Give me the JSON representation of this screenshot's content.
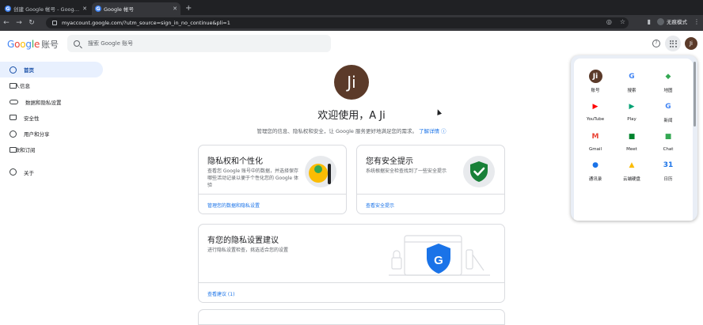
{
  "browser": {
    "tabs": [
      {
        "title": "创建 Google 帐号 - Google 帐号",
        "active": false
      },
      {
        "title": "Google 帐号",
        "active": true
      }
    ],
    "new_tab": "+",
    "url": "myaccount.google.com/?utm_source=sign_in_no_continue&pli=1",
    "mode_label": "无痕模式"
  },
  "header": {
    "logo": "Google",
    "logo_suffix": "账号",
    "search_placeholder": "搜索 Google 账号",
    "avatar_initials": "Ji"
  },
  "sidebar": {
    "items": [
      {
        "label": "首页",
        "icon": "home-icon",
        "active": true
      },
      {
        "label": "个人信息",
        "icon": "person-card-icon",
        "active": false
      },
      {
        "label": "数据和隐私设置",
        "icon": "toggle-icon",
        "active": false
      },
      {
        "label": "安全性",
        "icon": "lock-icon",
        "active": false
      },
      {
        "label": "用户和分享",
        "icon": "people-icon",
        "active": false
      },
      {
        "label": "付款和订阅",
        "icon": "credit-card-icon",
        "active": false
      }
    ],
    "about": {
      "label": "关于",
      "icon": "info-icon"
    }
  },
  "main": {
    "avatar_initials": "Ji",
    "welcome": "欢迎使用，A Ji",
    "subtitle": "管理您的信息、隐私权和安全，让 Google 服务更好地满足您的需求。",
    "subtitle_link": "了解详情",
    "cards": {
      "privacy": {
        "title": "隐私权和个性化",
        "desc": "查看您 Google 账号中的数据，并选择保存哪些活动记录以便于个性化您的 Google 体验",
        "link": "管理您的数据和隐私设置"
      },
      "security": {
        "title": "您有安全提示",
        "desc": "系统根据安全检查找到了一些安全提示",
        "link": "查看安全提示"
      },
      "recommendations": {
        "title": "有您的隐私设置建议",
        "desc": "进行隐私设置检查，挑选适合您的设置",
        "link": "查看建议 (1)"
      }
    }
  },
  "apps_panel": {
    "apps": [
      {
        "label": "账号",
        "glyph": "Ji",
        "color": "#5b3a29",
        "fg": "#ffffff",
        "icon": "account-avatar-icon"
      },
      {
        "label": "搜索",
        "glyph": "G",
        "color": "#ffffff",
        "fg": "#4285f4",
        "icon": "google-search-icon"
      },
      {
        "label": "地图",
        "glyph": "◆",
        "color": "#ffffff",
        "fg": "#34a853",
        "icon": "maps-icon"
      },
      {
        "label": "YouTube",
        "glyph": "▶",
        "color": "#ffffff",
        "fg": "#ff0000",
        "icon": "youtube-icon"
      },
      {
        "label": "Play",
        "glyph": "▶",
        "color": "#ffffff",
        "fg": "#00a173",
        "icon": "play-icon"
      },
      {
        "label": "新闻",
        "glyph": "G",
        "color": "#ffffff",
        "fg": "#4285f4",
        "icon": "news-icon"
      },
      {
        "label": "Gmail",
        "glyph": "M",
        "color": "#ffffff",
        "fg": "#ea4335",
        "icon": "gmail-icon"
      },
      {
        "label": "Meet",
        "glyph": "■",
        "color": "#ffffff",
        "fg": "#00832d",
        "icon": "meet-icon"
      },
      {
        "label": "Chat",
        "glyph": "■",
        "color": "#ffffff",
        "fg": "#34a853",
        "icon": "chat-icon"
      },
      {
        "label": "通讯录",
        "glyph": "●",
        "color": "#ffffff",
        "fg": "#1a73e8",
        "icon": "contacts-icon"
      },
      {
        "label": "云端硬盘",
        "glyph": "▲",
        "color": "#ffffff",
        "fg": "#fbbc04",
        "icon": "drive-icon"
      },
      {
        "label": "日历",
        "glyph": "31",
        "color": "#ffffff",
        "fg": "#1a73e8",
        "icon": "calendar-icon"
      }
    ]
  }
}
